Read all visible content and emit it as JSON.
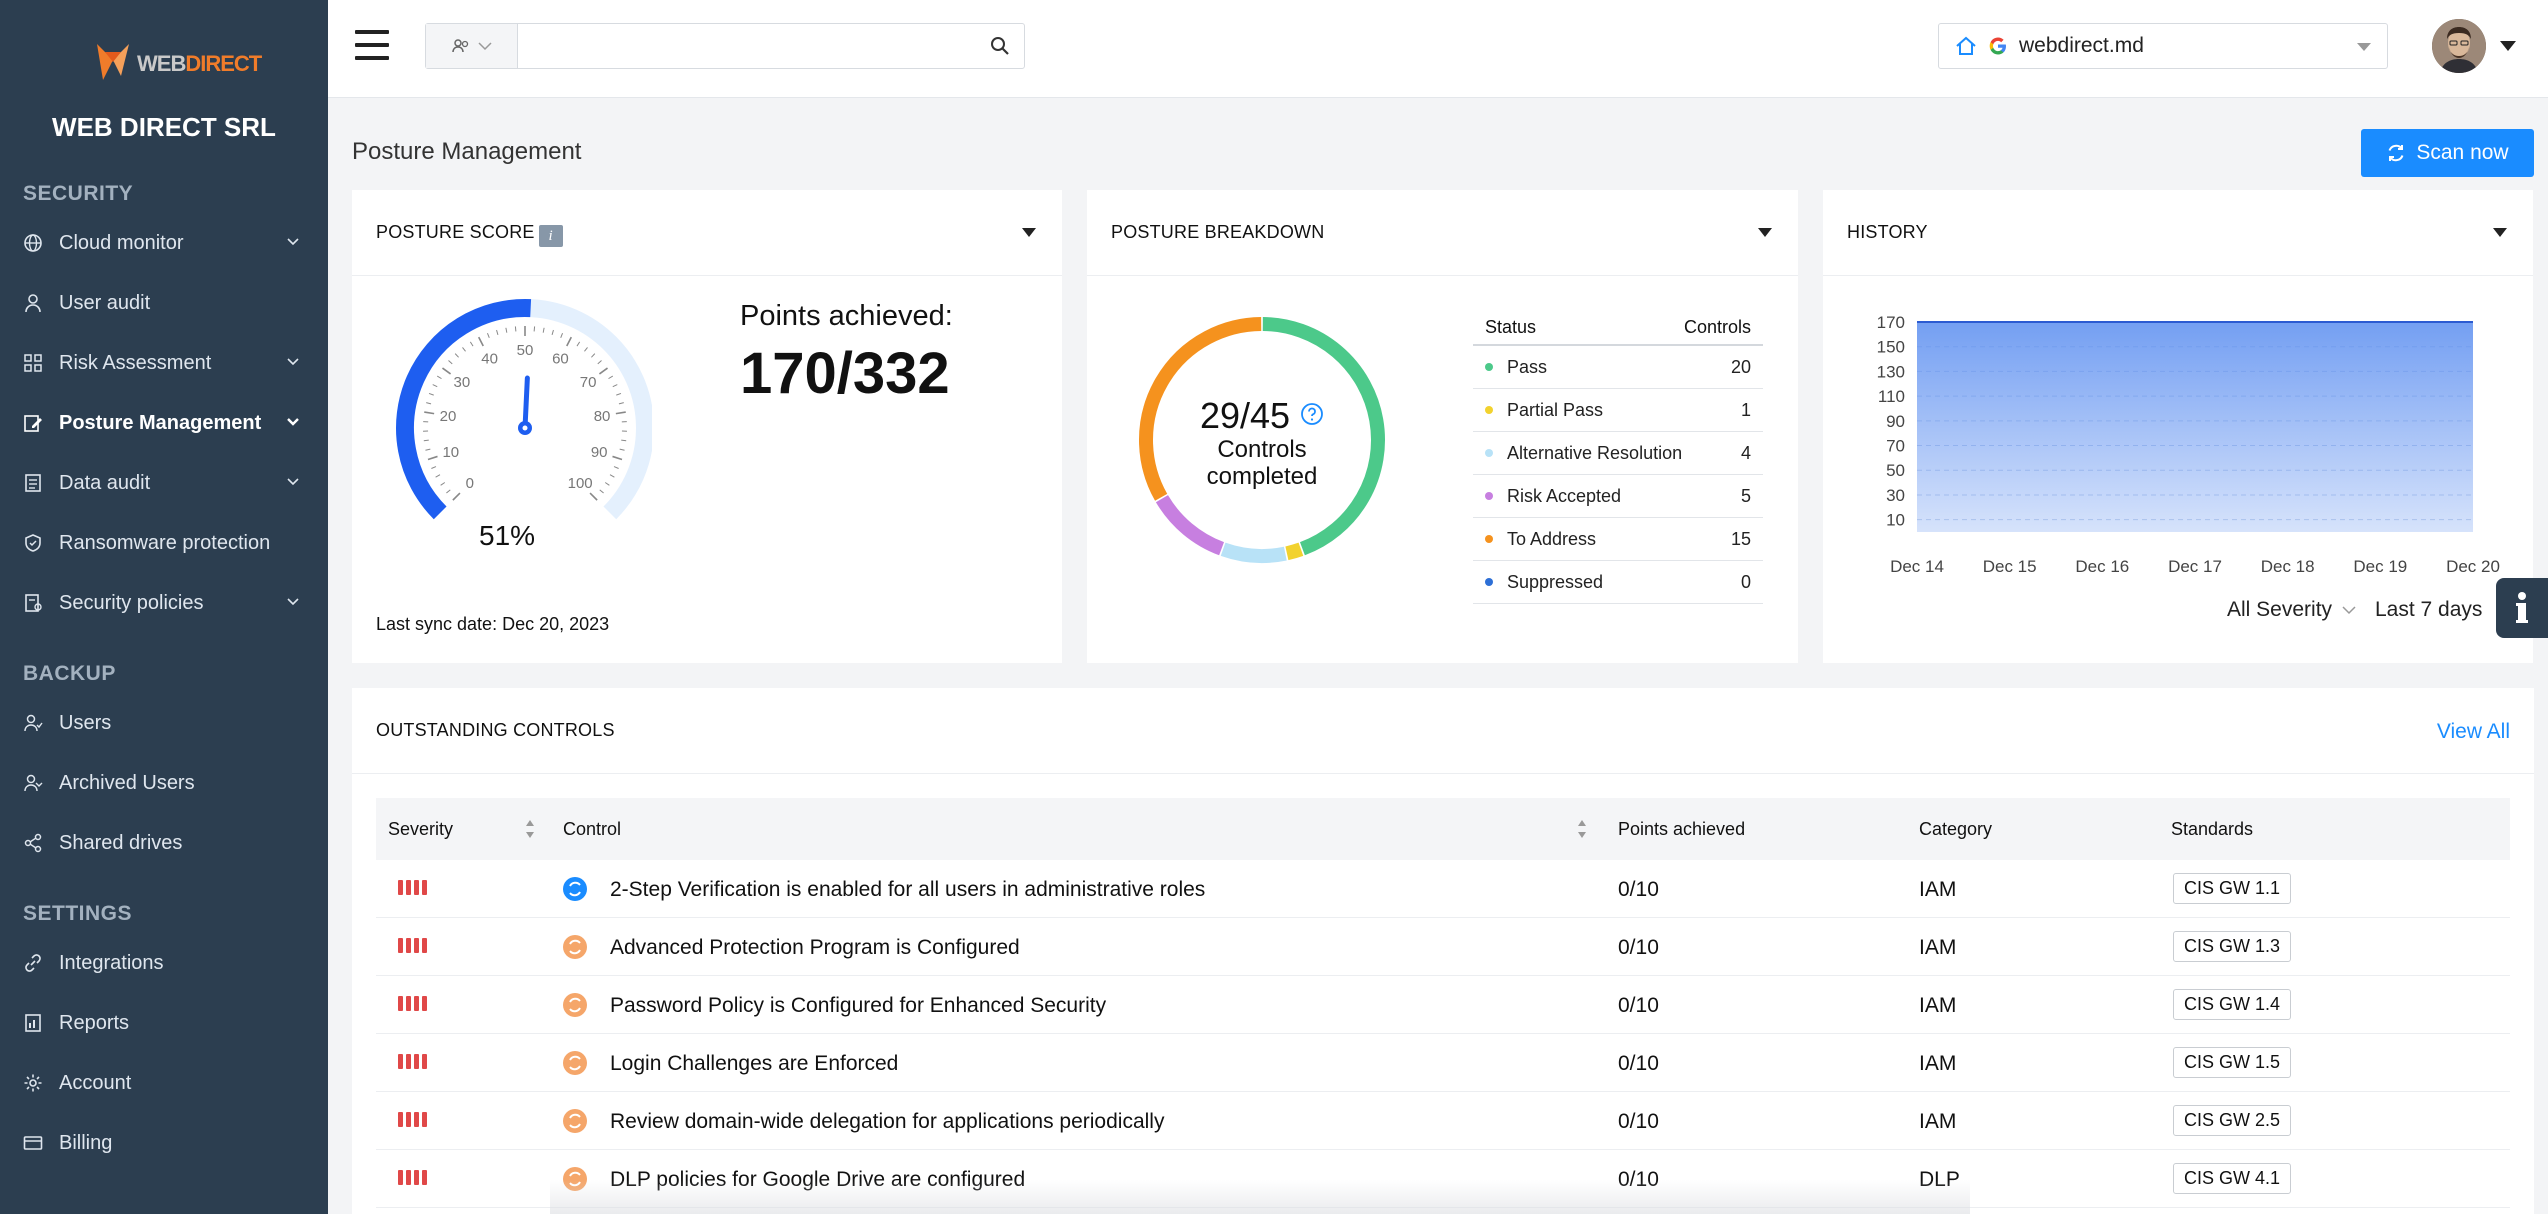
{
  "brand": {
    "logo_text_a": "WEB",
    "logo_text_b": "DIRECT",
    "org_name": "WEB DIRECT SRL"
  },
  "sidebar": {
    "sections": [
      "SECURITY",
      "BACKUP",
      "SETTINGS"
    ],
    "items": [
      {
        "label": "Cloud monitor",
        "icon": "globe-icon",
        "chevron": true
      },
      {
        "label": "User audit",
        "icon": "user-icon",
        "chevron": false
      },
      {
        "label": "Risk Assessment",
        "icon": "grid-icon",
        "chevron": true
      },
      {
        "label": "Posture Management",
        "icon": "edit-icon",
        "chevron": true,
        "active": true
      },
      {
        "label": "Data audit",
        "icon": "document-icon",
        "chevron": true
      },
      {
        "label": "Ransomware protection",
        "icon": "shield-icon",
        "chevron": false
      },
      {
        "label": "Security policies",
        "icon": "policy-icon",
        "chevron": true
      },
      {
        "label": "Users",
        "icon": "users-icon",
        "chevron": false
      },
      {
        "label": "Archived Users",
        "icon": "archived-users-icon",
        "chevron": false
      },
      {
        "label": "Shared drives",
        "icon": "share-icon",
        "chevron": false
      },
      {
        "label": "Integrations",
        "icon": "link-icon",
        "chevron": false
      },
      {
        "label": "Reports",
        "icon": "report-icon",
        "chevron": false
      },
      {
        "label": "Account",
        "icon": "gear-icon",
        "chevron": false
      },
      {
        "label": "Billing",
        "icon": "card-icon",
        "chevron": false
      }
    ]
  },
  "topbar": {
    "search_value": "",
    "search_placeholder": "",
    "domain": "webdirect.md"
  },
  "page": {
    "title": "Posture Management",
    "scan_label": "Scan now"
  },
  "posture_score": {
    "title": "POSTURE SCORE",
    "info": "i",
    "gauge_percent": "51%",
    "gauge_fraction": 0.51,
    "gauge_ticks": [
      "0",
      "10",
      "20",
      "30",
      "40",
      "50",
      "60",
      "70",
      "80",
      "90",
      "100"
    ],
    "points_label": "Points achieved:",
    "points_value": "170/332",
    "sync": "Last sync date: Dec 20, 2023"
  },
  "breakdown": {
    "title": "POSTURE BREAKDOWN",
    "center_value": "29/45",
    "center_label_1": "Controls",
    "center_label_2": "completed",
    "header_status": "Status",
    "header_controls": "Controls",
    "rows": [
      {
        "label": "Pass",
        "value": "20",
        "color": "#4cc98a"
      },
      {
        "label": "Partial Pass",
        "value": "1",
        "color": "#f2d22e"
      },
      {
        "label": "Alternative Resolution",
        "value": "4",
        "color": "#b8e2f7"
      },
      {
        "label": "Risk Accepted",
        "value": "5",
        "color": "#c77fe0"
      },
      {
        "label": "To Address",
        "value": "15",
        "color": "#f5921e"
      },
      {
        "label": "Suppressed",
        "value": "0",
        "color": "#2d6fd6"
      }
    ]
  },
  "history": {
    "title": "HISTORY",
    "severity_filter": "All Severity",
    "range_filter": "Last 7 days",
    "chart_data": {
      "type": "area",
      "x": [
        "Dec 14",
        "Dec 15",
        "Dec 16",
        "Dec 17",
        "Dec 18",
        "Dec 19",
        "Dec 20"
      ],
      "y_ticks": [
        "170",
        "150",
        "130",
        "110",
        "90",
        "70",
        "50",
        "30",
        "10"
      ],
      "values": [
        170,
        170,
        170,
        170,
        170,
        170,
        170
      ],
      "ylim": [
        0,
        170
      ],
      "grid": true,
      "color": "#5b8ef0"
    }
  },
  "outstanding": {
    "title": "OUTSTANDING CONTROLS",
    "view_all": "View All",
    "headers": {
      "severity": "Severity",
      "control": "Control",
      "points": "Points achieved",
      "category": "Category",
      "standards": "Standards"
    },
    "rows": [
      {
        "control": "2-Step Verification is enabled for all users in administrative roles",
        "points": "0/10",
        "category": "IAM",
        "standard": "CIS GW 1.1",
        "icon_color": "#1a8cff"
      },
      {
        "control": "Advanced Protection Program is Configured",
        "points": "0/10",
        "category": "IAM",
        "standard": "CIS GW 1.3",
        "icon_color": "#f5a66a"
      },
      {
        "control": "Password Policy is Configured for Enhanced Security",
        "points": "0/10",
        "category": "IAM",
        "standard": "CIS GW 1.4",
        "icon_color": "#f5a66a"
      },
      {
        "control": "Login Challenges are Enforced",
        "points": "0/10",
        "category": "IAM",
        "standard": "CIS GW 1.5",
        "icon_color": "#f5a66a"
      },
      {
        "control": "Review domain-wide delegation for applications periodically",
        "points": "0/10",
        "category": "IAM",
        "standard": "CIS GW 2.5",
        "icon_color": "#f5a66a"
      },
      {
        "control": "DLP policies for Google Drive are configured",
        "points": "0/10",
        "category": "DLP",
        "standard": "CIS GW 4.1",
        "icon_color": "#f5a66a"
      }
    ]
  }
}
